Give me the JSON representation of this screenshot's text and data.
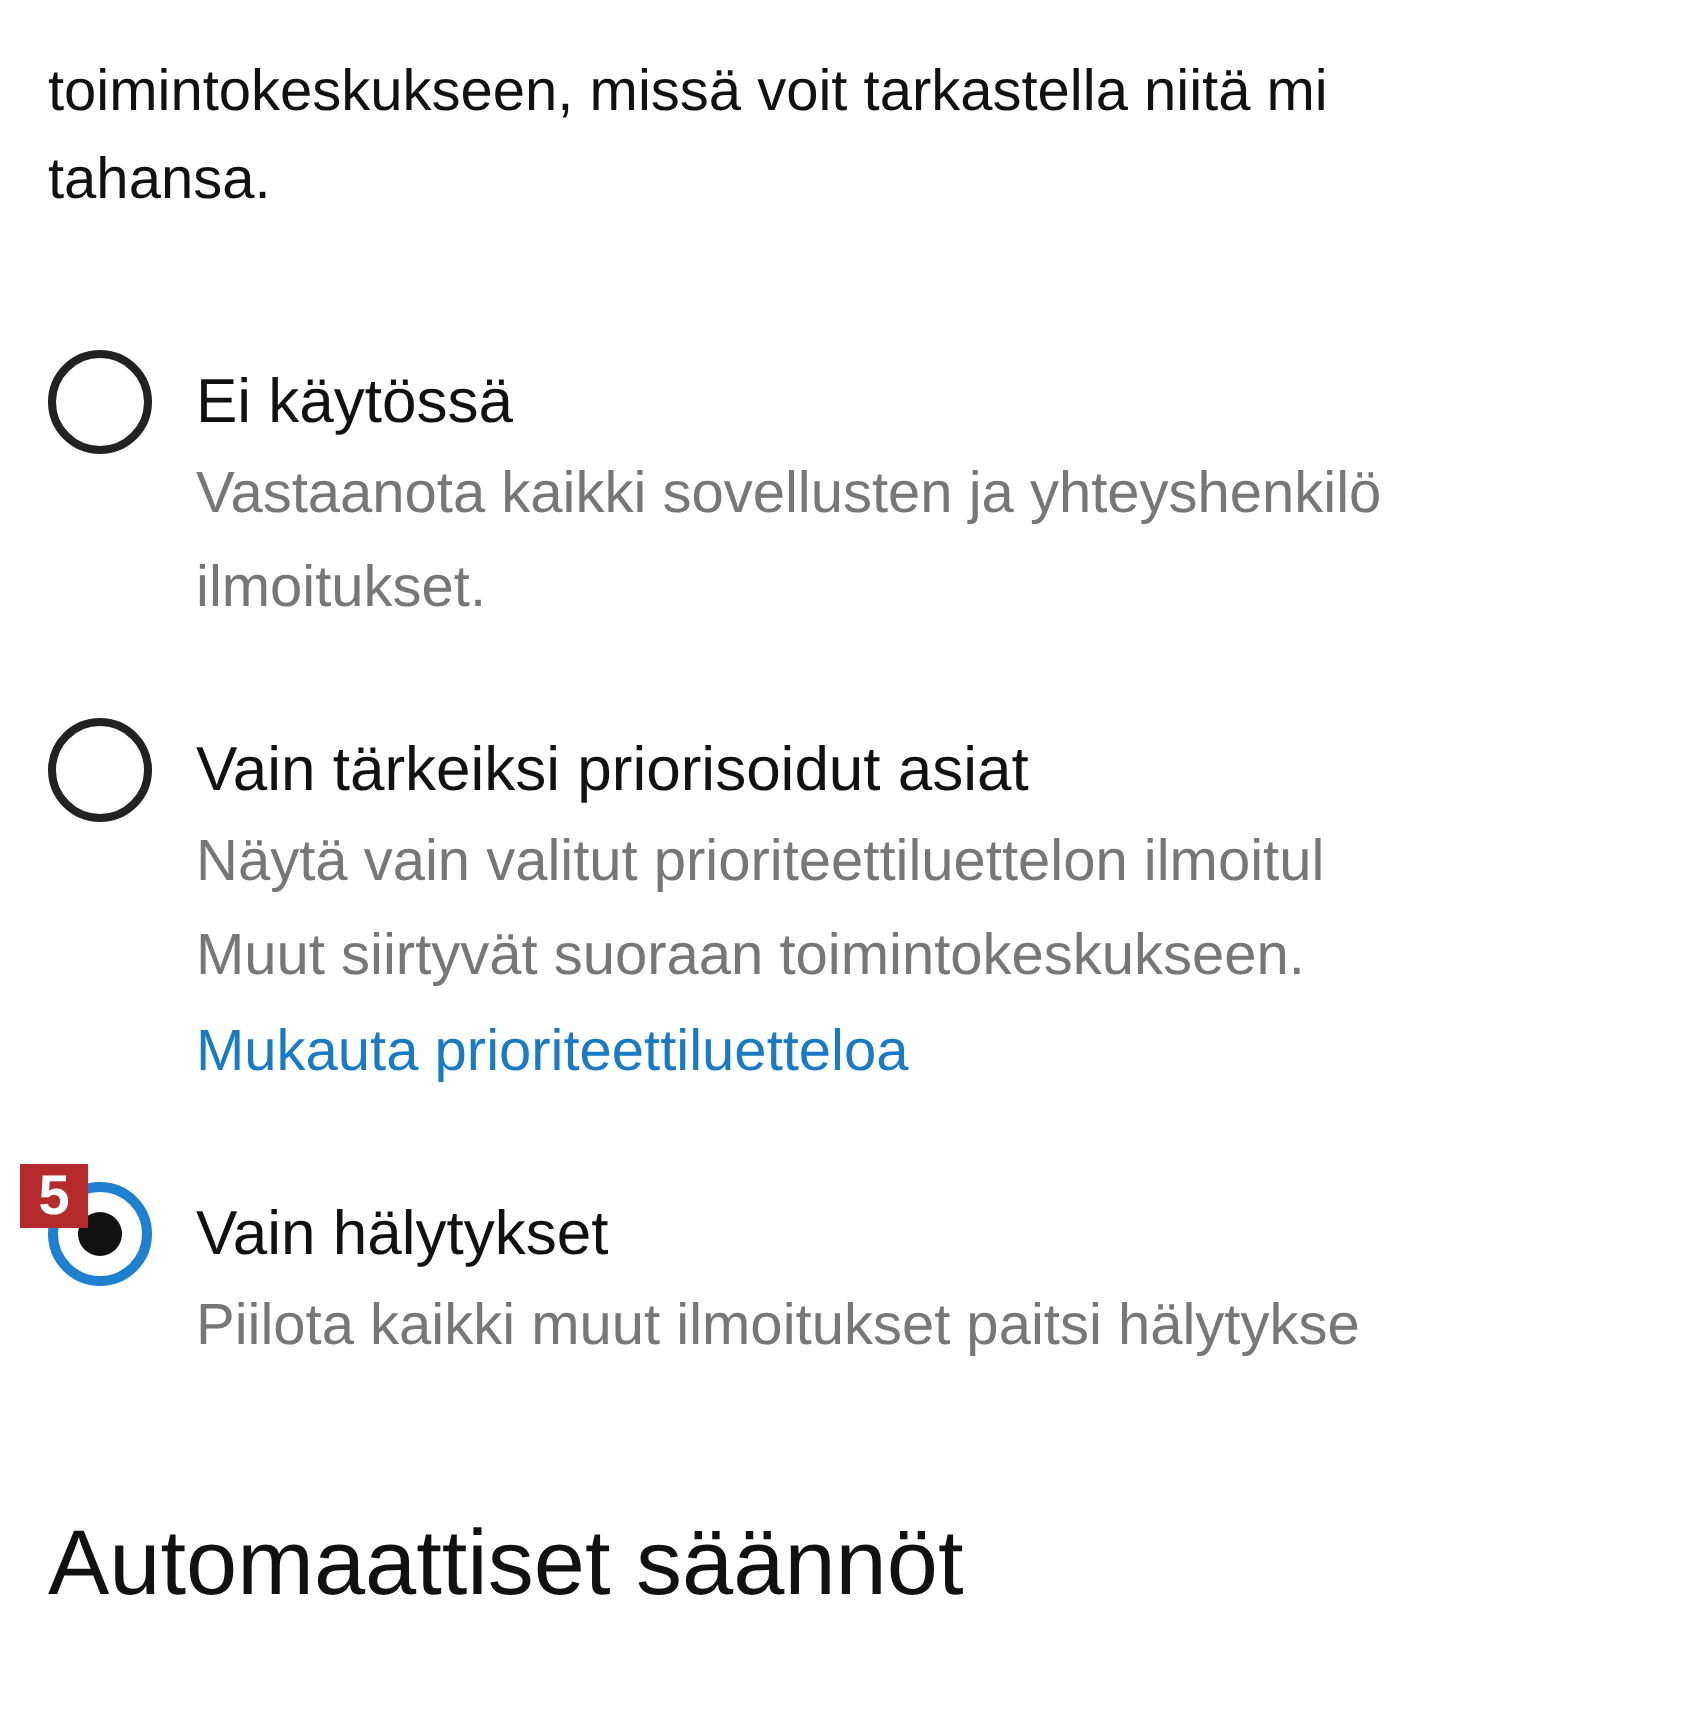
{
  "intro": [
    "toimintokeskukseen, missä voit tarkastella niitä mi",
    "tahansa."
  ],
  "options": [
    {
      "label": "Ei käytössä",
      "selected": false,
      "description": [
        "Vastaanota kaikki sovellusten ja yhteyshenkilö",
        "ilmoitukset."
      ]
    },
    {
      "label": "Vain tärkeiksi priorisoidut asiat",
      "selected": false,
      "description": [
        "Näytä vain valitut prioriteettiluettelon ilmoitul",
        "Muut siirtyvät suoraan toimintokeskukseen."
      ],
      "link": "Mukauta prioriteettiluetteloa"
    },
    {
      "label": "Vain hälytykset",
      "selected": true,
      "description": [
        "Piilota kaikki muut ilmoitukset paitsi hälytykse"
      ],
      "callout": "5"
    }
  ],
  "heading": "Automaattiset säännöt"
}
